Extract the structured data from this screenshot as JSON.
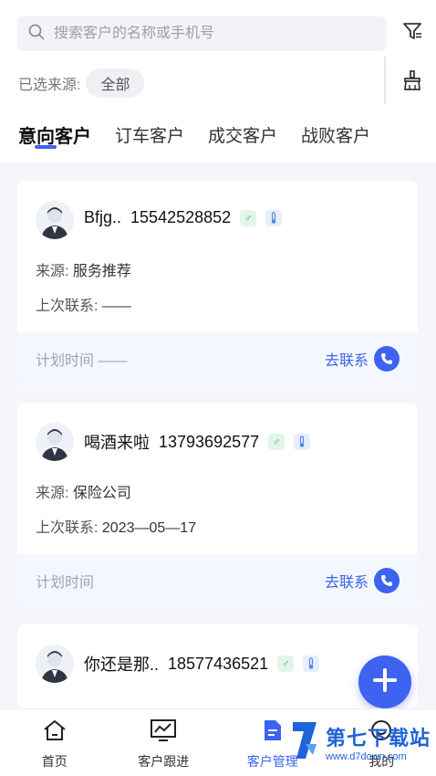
{
  "search": {
    "placeholder": "搜索客户的名称或手机号"
  },
  "source_filter": {
    "label": "已选来源:",
    "selected": "全部"
  },
  "tabs": [
    "意向客户",
    "订车客户",
    "成交客户",
    "战败客户"
  ],
  "customers": [
    {
      "name": "Bfjg..",
      "phone": "15542528852",
      "source_key": "来源:",
      "source": "服务推荐",
      "last_key": "上次联系:",
      "last_contact": "——",
      "plan_text": "计划时间 ——",
      "contact_label": "去联系"
    },
    {
      "name": "喝酒来啦",
      "phone": "13793692577",
      "source_key": "来源:",
      "source": "保险公司",
      "last_key": "上次联系:",
      "last_contact": "2023—05—17",
      "plan_text": "计划时间",
      "contact_label": "去联系"
    },
    {
      "name": "你还是那..",
      "phone": "18577436521"
    }
  ],
  "badges": {
    "gender": "♂",
    "thermo": "🌡"
  },
  "nav": [
    {
      "label": "首页",
      "icon": "home-icon"
    },
    {
      "label": "客户跟进",
      "icon": "chart-icon"
    },
    {
      "label": "客户管理",
      "icon": "document-icon"
    },
    {
      "label": "我的",
      "icon": "user-icon"
    }
  ],
  "watermark": {
    "main": "第七下载站",
    "url": "www.d7down.com"
  },
  "colors": {
    "accent": "#3d63f0",
    "green": "#3fb36b"
  }
}
